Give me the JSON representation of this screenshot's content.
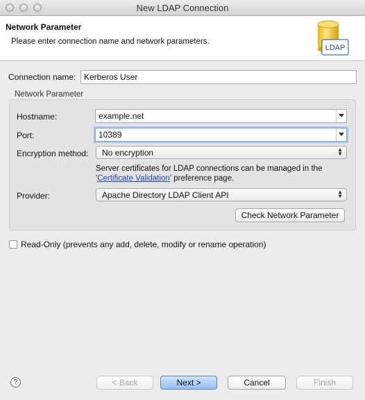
{
  "window": {
    "title": "New LDAP Connection"
  },
  "header": {
    "title": "Network Parameter",
    "description": "Please enter connection name and network parameters.",
    "logo_text": "LDAP"
  },
  "connection": {
    "label": "Connection name:",
    "value": "Kerberos User"
  },
  "network_group": {
    "title": "Network Parameter",
    "hostname": {
      "label": "Hostname:",
      "value": "example.net"
    },
    "port": {
      "label": "Port:",
      "value": "10389"
    },
    "encryption": {
      "label": "Encryption method:",
      "value": "No encryption"
    },
    "cert_note": {
      "line1": "Server certificates for LDAP connections can be managed in the",
      "quote_open": "'",
      "link": "Certificate Validation",
      "line2_rest": "' preference page."
    },
    "provider": {
      "label": "Provider:",
      "value": "Apache Directory LDAP Client API"
    },
    "check_button": "Check Network Parameter"
  },
  "readonly": {
    "label": "Read-Only (prevents any add, delete, modify or rename operation)",
    "checked": false
  },
  "footer": {
    "help_glyph": "?",
    "back": "< Back",
    "next": "Next >",
    "cancel": "Cancel",
    "finish": "Finish"
  }
}
